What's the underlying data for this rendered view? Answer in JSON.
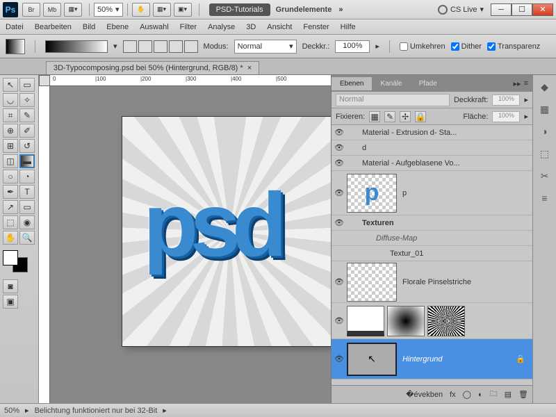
{
  "titlebar": {
    "ps": "Ps",
    "br": "Br",
    "mb": "Mb",
    "zoom": "50%",
    "doc_badge": "PSD-Tutorials",
    "category": "Grundelemente",
    "cslive": "CS Live"
  },
  "menubar": [
    "Datei",
    "Bearbeiten",
    "Bild",
    "Ebene",
    "Auswahl",
    "Filter",
    "Analyse",
    "3D",
    "Ansicht",
    "Fenster",
    "Hilfe"
  ],
  "optbar": {
    "modus_label": "Modus:",
    "modus_value": "Normal",
    "deckkr_label": "Deckkr.:",
    "deckkr_value": "100%",
    "umkehren": "Umkehren",
    "dither": "Dither",
    "transparenz": "Transparenz"
  },
  "doctab": {
    "title": "3D-Typocomposing.psd bei 50% (Hintergrund, RGB/8) *"
  },
  "ruler_marks": [
    "0",
    "100",
    "200",
    "300",
    "400",
    "500"
  ],
  "panels": {
    "tabs": [
      "Ebenen",
      "Kanäle",
      "Pfade"
    ],
    "blend_mode": "Normal",
    "opacity_label": "Deckkraft:",
    "opacity_value": "100%",
    "lock_label": "Fixieren:",
    "fill_label": "Fläche:",
    "fill_value": "100%",
    "layers": [
      {
        "name": "Material - Extrusion d- Sta...",
        "eye": true,
        "indent": 1
      },
      {
        "name": "d",
        "eye": true,
        "indent": 1
      },
      {
        "name": "Material - Aufgeblasene Vo...",
        "eye": true,
        "indent": 1
      },
      {
        "name": "p",
        "eye": true,
        "thumb": "p",
        "indent": 0
      },
      {
        "name": "Texturen",
        "eye": true,
        "indent": 1,
        "bold": true
      },
      {
        "name": "Diffuse-Map",
        "indent": 2,
        "italic": true
      },
      {
        "name": "Textur_01",
        "indent": 3
      },
      {
        "name": "Florale Pinselstriche",
        "eye": true,
        "thumb": "checker",
        "indent": 0
      },
      {
        "name": "",
        "eye": true,
        "triple": true
      },
      {
        "name": "Hintergrund",
        "eye": true,
        "selected": true,
        "locked": true
      }
    ]
  },
  "statusbar": {
    "zoom": "50%",
    "msg": "Belichtung funktioniert nur bei 32-Bit"
  }
}
